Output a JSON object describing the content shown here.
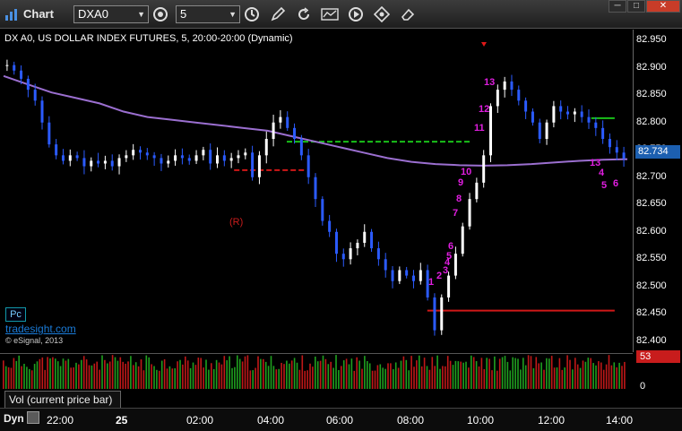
{
  "window": {
    "title": "Chart",
    "symbol": "DXA0",
    "interval": "5",
    "icons": [
      "link-icon",
      "history-icon",
      "drawing-pencil-icon",
      "refresh-icon",
      "study-icon",
      "play-icon",
      "tools-icon"
    ],
    "controls": [
      "minimize",
      "maximize",
      "close"
    ]
  },
  "chart": {
    "label": "DX A0, US DOLLAR INDEX FUTURES, 5, 20:00-20:00 (Dynamic)",
    "price_ticks": [
      "82.950",
      "82.900",
      "82.850",
      "82.800",
      "82.750",
      "82.700",
      "82.650",
      "82.600",
      "82.550",
      "82.500",
      "82.450",
      "82.400"
    ],
    "current_price": "82.734",
    "annotation_r": "(R)",
    "pc_badge": "Pc",
    "watermark": "tradesight.com",
    "copyright": "© eSignal, 2013"
  },
  "volume": {
    "label": "Vol (current price bar)",
    "current_value": "53",
    "zero_tick": "0"
  },
  "time_axis": {
    "dyn_label": "Dyn",
    "ticks": [
      "22:00",
      "25",
      "02:00",
      "04:00",
      "06:00",
      "08:00",
      "10:00",
      "12:00",
      "14:00"
    ]
  },
  "chart_data": {
    "type": "candlestick",
    "title": "DX A0, US DOLLAR INDEX FUTURES, 5, 20:00-20:00 (Dynamic)",
    "ylim": [
      82.38,
      82.97
    ],
    "y_ticks": [
      82.95,
      82.9,
      82.85,
      82.8,
      82.75,
      82.7,
      82.65,
      82.6,
      82.55,
      82.5,
      82.45,
      82.4
    ],
    "x_ticks": [
      "22:00",
      "25",
      "02:00",
      "04:00",
      "06:00",
      "08:00",
      "10:00",
      "12:00",
      "14:00"
    ],
    "close_series": [
      82.905,
      82.895,
      82.88,
      82.86,
      82.84,
      82.8,
      82.76,
      82.74,
      82.73,
      82.74,
      82.735,
      82.72,
      82.73,
      82.725,
      82.73,
      82.72,
      82.735,
      82.74,
      82.75,
      82.745,
      82.74,
      82.735,
      82.725,
      82.73,
      82.74,
      82.735,
      82.73,
      82.74,
      82.75,
      82.725,
      82.74,
      82.73,
      82.735,
      82.74,
      82.745,
      82.7,
      82.74,
      82.77,
      82.8,
      82.81,
      82.79,
      82.77,
      82.74,
      82.7,
      82.66,
      82.62,
      82.6,
      82.56,
      82.55,
      82.57,
      82.58,
      82.6,
      82.57,
      82.55,
      82.53,
      82.51,
      82.53,
      82.52,
      82.51,
      82.53,
      82.48,
      82.42,
      82.48,
      82.52,
      82.56,
      82.61,
      82.66,
      82.69,
      82.74,
      82.83,
      82.86,
      82.875,
      82.86,
      82.84,
      82.82,
      82.8,
      82.77,
      82.8,
      82.83,
      82.82,
      82.815,
      82.82,
      82.81,
      82.8,
      82.79,
      82.77,
      82.755,
      82.745,
      82.734
    ],
    "moving_average": [
      82.885,
      82.87,
      82.855,
      82.845,
      82.835,
      82.82,
      82.81,
      82.805,
      82.8,
      82.795,
      82.79,
      82.785,
      82.775,
      82.765,
      82.755,
      82.745,
      82.735,
      82.728,
      82.724,
      82.722,
      82.721,
      82.722,
      82.724,
      82.727,
      82.73,
      82.732,
      82.733
    ],
    "horizontal_levels": [
      {
        "price": 82.713,
        "color": "#d01818",
        "style": "dashed",
        "start": "03:00",
        "end": "05:00"
      },
      {
        "price": 82.765,
        "color": "#19c019",
        "style": "dashed",
        "start": "04:30",
        "end": "09:45"
      },
      {
        "price": 82.808,
        "color": "#19c019",
        "style": "solid",
        "start": "13:10",
        "end": "13:50"
      },
      {
        "price": 82.456,
        "color": "#d01818",
        "style": "solid",
        "start": "08:30",
        "end": "13:50"
      }
    ],
    "td_counts_magenta": [
      "1",
      "2",
      "3",
      "4",
      "5",
      "6",
      "7",
      "8",
      "9",
      "10",
      "11",
      "12",
      "13"
    ],
    "td_counts_right": [
      "13",
      "4",
      "5",
      "6"
    ]
  },
  "colors": {
    "up_candle": "#ffffff",
    "down_candle": "#2b5bff",
    "moving_average": "#9b6fd0",
    "count_magenta": "#e01ee0",
    "count_yellow": "#e8d000",
    "count_green": "#1f9a1f",
    "volume_up": "#1fa01f",
    "volume_down": "#c01818",
    "current_price_badge": "#1c5fb0"
  }
}
